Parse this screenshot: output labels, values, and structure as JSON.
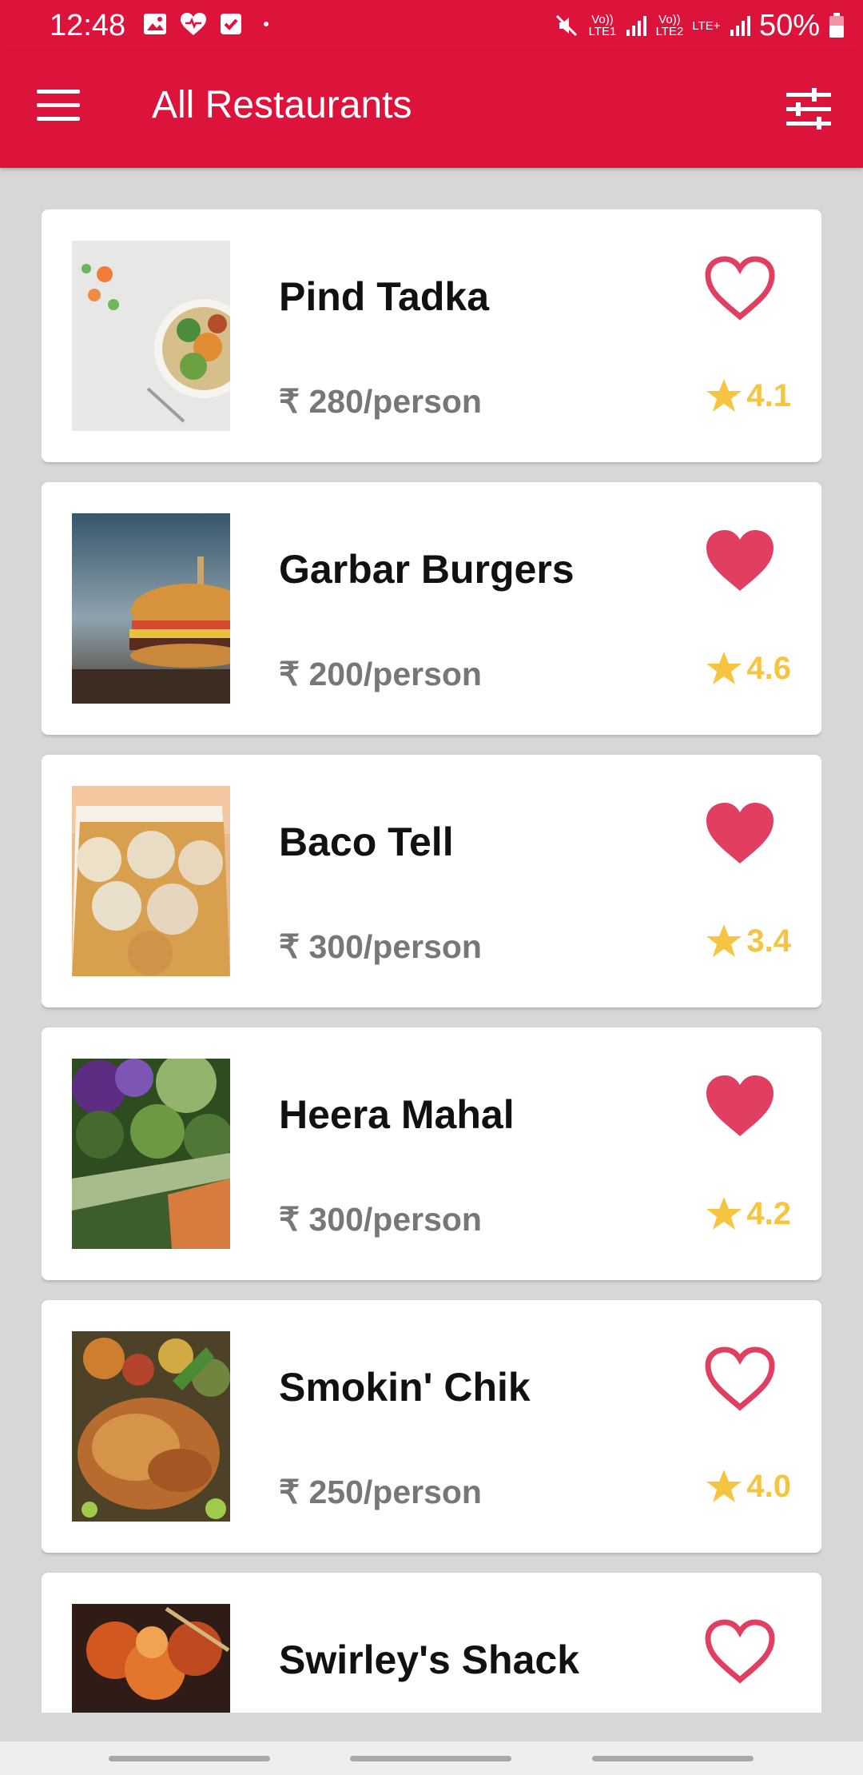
{
  "status_bar": {
    "time": "12:48",
    "battery": "50%",
    "network_1": "Vo)) LTE1",
    "network_2": "Vo)) LTE2",
    "network_3": "LTE+",
    "left_icons": [
      "image-icon",
      "heart-notification-icon",
      "check-box-icon",
      "dot-icon"
    ],
    "right_icons": [
      "mute-icon",
      "signal-icon",
      "signal-icon",
      "battery-icon"
    ]
  },
  "appbar": {
    "title": "All Restaurants",
    "menu_icon": "hamburger-menu-icon",
    "filter_icon": "sliders-icon"
  },
  "restaurants": [
    {
      "name": "Pind Tadka",
      "price": "₹ 280/person",
      "rating": "4.1",
      "favorite": false,
      "image": "salad-and-vegetables-photo"
    },
    {
      "name": "Garbar Burgers",
      "price": "₹ 200/person",
      "rating": "4.6",
      "favorite": true,
      "image": "burger-photo"
    },
    {
      "name": "Baco Tell",
      "price": "₹ 300/person",
      "rating": "3.4",
      "favorite": true,
      "image": "tacos-photo"
    },
    {
      "name": "Heera Mahal",
      "price": "₹ 300/person",
      "rating": "4.2",
      "favorite": true,
      "image": "vegetables-photo"
    },
    {
      "name": "Smokin' Chik",
      "price": "₹ 250/person",
      "rating": "4.0",
      "favorite": false,
      "image": "roast-chicken-photo"
    },
    {
      "name": "Swirley's Shack",
      "price": "",
      "rating": "",
      "favorite": false,
      "image": "grilled-skewers-photo"
    }
  ],
  "colors": {
    "primary": "#dc143c",
    "favorite": "#e13f61",
    "rating": "#f5c542",
    "background": "#d7d7d7"
  }
}
